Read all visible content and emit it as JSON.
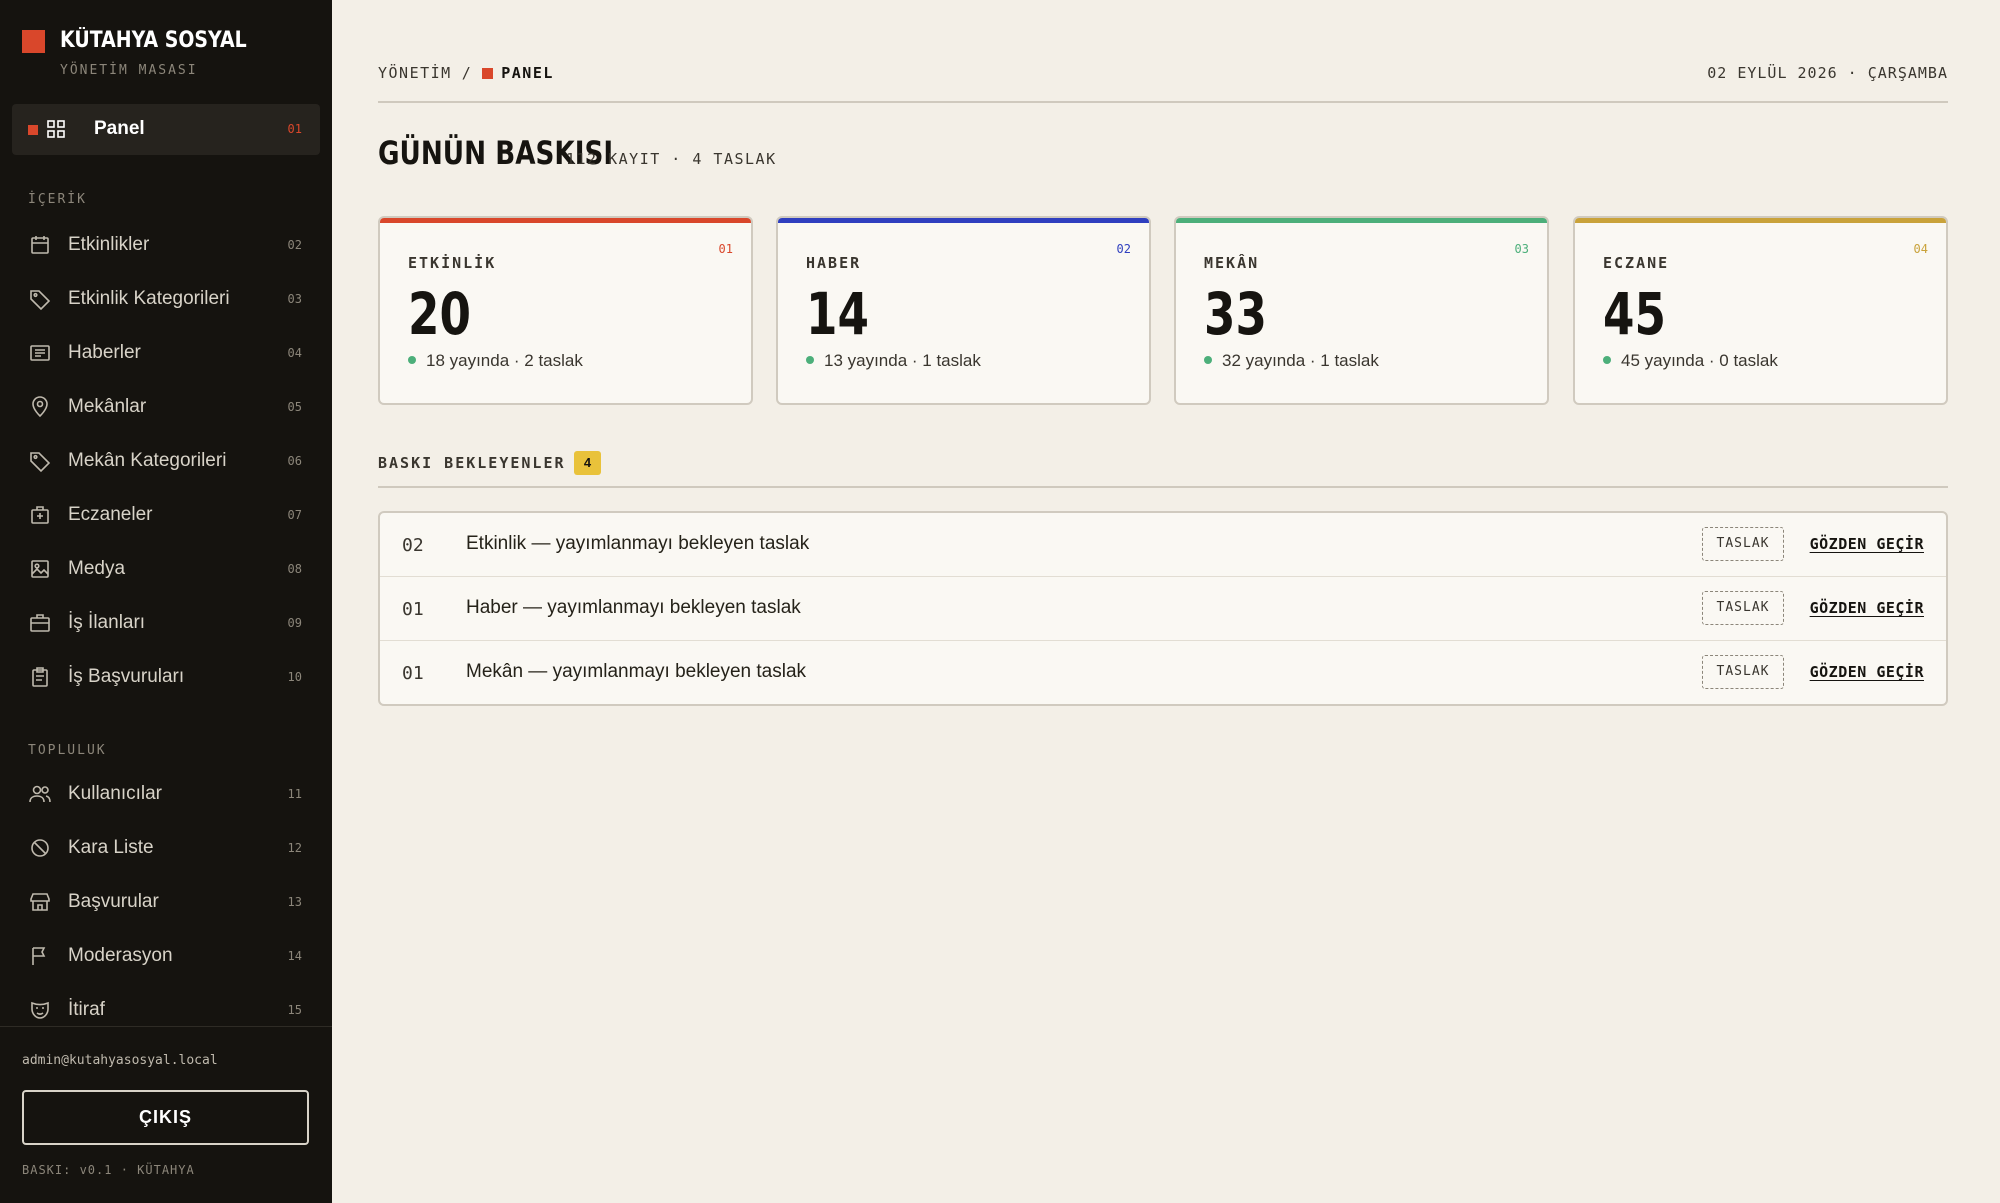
{
  "brand": {
    "title": "KÜTAHYA SOSYAL",
    "subtitle": "YÖNETİM MASASI"
  },
  "nav_active": {
    "label": "Panel",
    "num": "01",
    "icon": "grid-icon"
  },
  "sections": [
    {
      "label": "İÇERİK"
    },
    {
      "label": "TOPLULUK"
    }
  ],
  "nav_items": [
    {
      "label": "Etkinlikler",
      "num": "02",
      "icon": "calendar-icon"
    },
    {
      "label": "Etkinlik Kategorileri",
      "num": "03",
      "icon": "tag-icon"
    },
    {
      "label": "Haberler",
      "num": "04",
      "icon": "newspaper-icon"
    },
    {
      "label": "Mekânlar",
      "num": "05",
      "icon": "map-pin-icon"
    },
    {
      "label": "Mekân Kategorileri",
      "num": "06",
      "icon": "tag-icon"
    },
    {
      "label": "Eczaneler",
      "num": "07",
      "icon": "medical-bag-icon"
    },
    {
      "label": "Medya",
      "num": "08",
      "icon": "image-icon"
    },
    {
      "label": "İş İlanları",
      "num": "09",
      "icon": "briefcase-icon"
    },
    {
      "label": "İş Başvuruları",
      "num": "10",
      "icon": "clipboard-icon"
    },
    {
      "label": "Kullanıcılar",
      "num": "11",
      "icon": "users-icon"
    },
    {
      "label": "Kara Liste",
      "num": "12",
      "icon": "ban-icon"
    },
    {
      "label": "Başvurular",
      "num": "13",
      "icon": "store-icon"
    },
    {
      "label": "Moderasyon",
      "num": "14",
      "icon": "flag-icon"
    },
    {
      "label": "İtiraf",
      "num": "15",
      "icon": "mask-icon"
    }
  ],
  "footer": {
    "email": "admin@kutahyasosyal.local",
    "logout_label": "ÇIKIŞ",
    "version": "BASKI: v0.1 · KÜTAHYA"
  },
  "breadcrumb": {
    "root": "YÖNETİM",
    "sep": "/",
    "current": "PANEL"
  },
  "date": "02 EYLÜL 2026 · ÇARŞAMBA",
  "page": {
    "title": "GÜNÜN BASKISI",
    "meta": "112 KAYIT · 4 TASLAK"
  },
  "cards": [
    {
      "num": "01",
      "label": "ETKİNLİK",
      "value": "20",
      "sub": "18 yayında · 2 taslak",
      "color": "#d9472b"
    },
    {
      "num": "02",
      "label": "HABER",
      "value": "14",
      "sub": "13 yayında · 1 taslak",
      "color": "#2f3fbf"
    },
    {
      "num": "03",
      "label": "MEKÂN",
      "value": "33",
      "sub": "32 yayında · 1 taslak",
      "color": "#4caf7a"
    },
    {
      "num": "04",
      "label": "ECZANE",
      "value": "45",
      "sub": "45 yayında · 0 taslak",
      "color": "#c9a23a"
    }
  ],
  "pending": {
    "title": "BASKI BEKLEYENLER",
    "count": "4",
    "rows": [
      {
        "num": "02",
        "text": "Etkinlik — yayımlanmayı bekleyen taslak",
        "tag": "TASLAK",
        "action": "GÖZDEN GEÇİR"
      },
      {
        "num": "01",
        "text": "Haber — yayımlanmayı bekleyen taslak",
        "tag": "TASLAK",
        "action": "GÖZDEN GEÇİR"
      },
      {
        "num": "01",
        "text": "Mekân — yayımlanmayı bekleyen taslak",
        "tag": "TASLAK",
        "action": "GÖZDEN GEÇİR"
      }
    ]
  }
}
